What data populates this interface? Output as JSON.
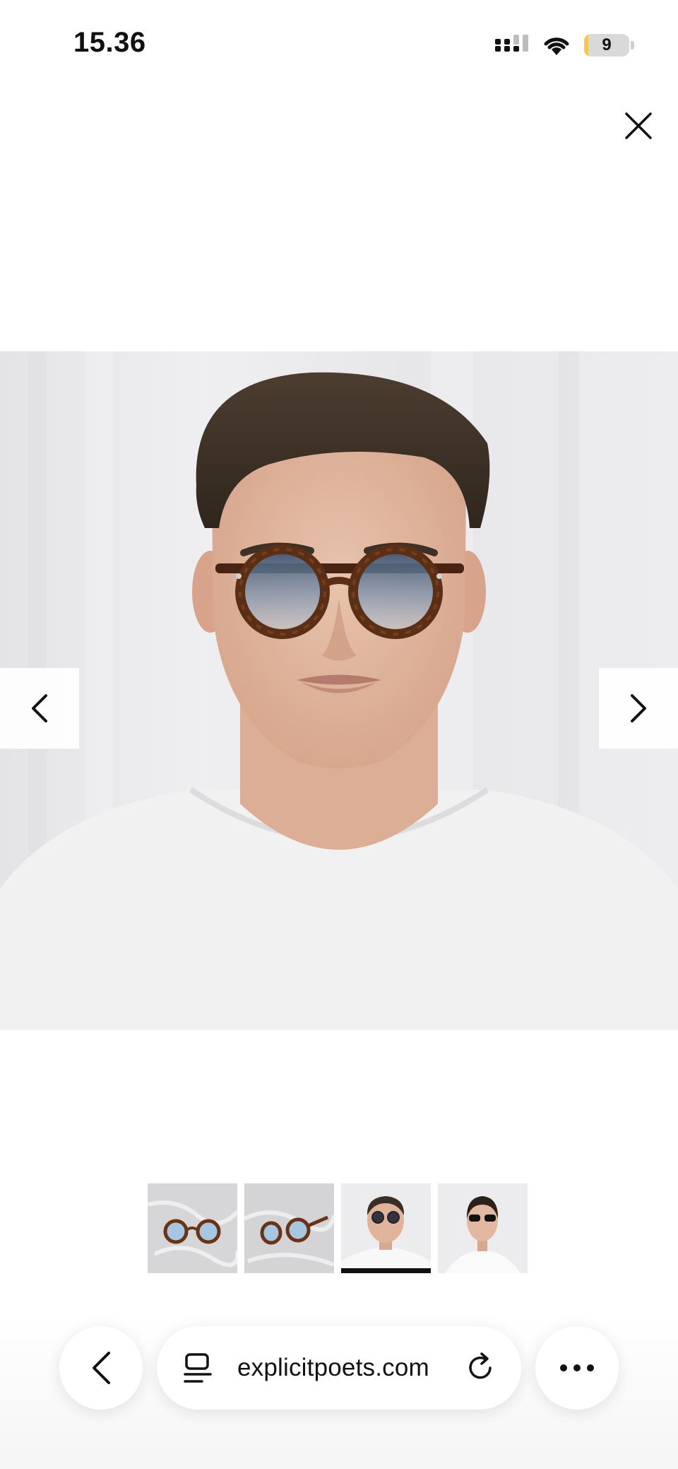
{
  "status_bar": {
    "time": "15.36",
    "battery_level": "9",
    "icons": [
      "cellular-signal-icon",
      "wifi-icon",
      "battery-icon"
    ]
  },
  "viewer": {
    "close_icon": "close-icon",
    "prev_icon": "chevron-left-icon",
    "next_icon": "chevron-right-icon",
    "active_thumbnail_index": 2,
    "thumbnails": [
      {
        "name": "glasses-front-marble"
      },
      {
        "name": "glasses-angle-marble"
      },
      {
        "name": "male-model-front"
      },
      {
        "name": "female-model-front"
      }
    ]
  },
  "browser_bar": {
    "url": "explicitpoets.com",
    "back_icon": "chevron-left-icon",
    "reader_icon": "page-menu-icon",
    "reload_icon": "reload-icon",
    "more_icon": "more-dots-icon"
  },
  "colors": {
    "battery_fill": "#f2c94c",
    "frame_tortoise": "#5b2e16",
    "lens_blue": "#7d96b2"
  }
}
